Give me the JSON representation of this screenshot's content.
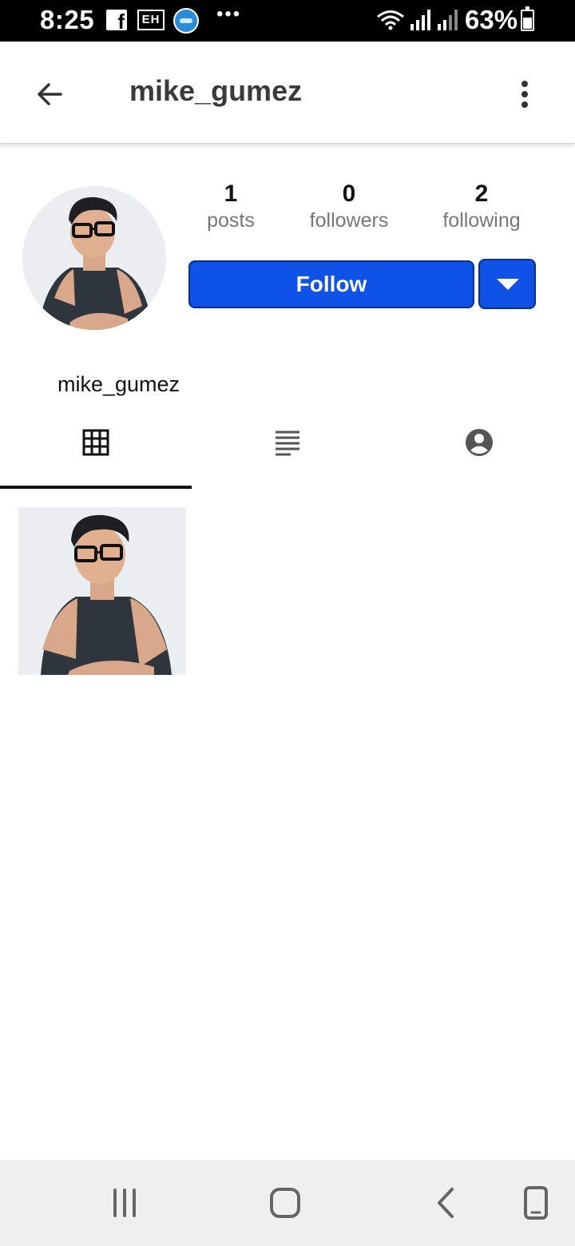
{
  "status_bar": {
    "time": "8:25",
    "battery": "63%",
    "battery_level": 0.63,
    "notification_icons": [
      "facebook-icon",
      "eh-icon",
      "globe-app-icon",
      "more-dots-icon"
    ],
    "system_icons": [
      "wifi-icon",
      "signal-icon",
      "signal-icon",
      "battery-icon"
    ]
  },
  "header": {
    "title": "mike_gumez",
    "back_icon": "arrow-left-icon",
    "menu_icon": "more-vert-icon"
  },
  "profile": {
    "username": "mike_gumez",
    "stats": [
      {
        "value": "1",
        "label": "posts"
      },
      {
        "value": "0",
        "label": "followers"
      },
      {
        "value": "2",
        "label": "following"
      }
    ],
    "follow_label": "Follow",
    "dropdown_icon": "caret-down-icon"
  },
  "tabs": [
    {
      "icon": "grid-icon",
      "active": true
    },
    {
      "icon": "list-icon",
      "active": false
    },
    {
      "icon": "person-circle-icon",
      "active": false
    }
  ],
  "posts_count": 1,
  "nav_bar": [
    "recents-icon",
    "home-icon",
    "back-icon",
    "rotate-icon"
  ],
  "colors": {
    "follow_button": "#0f52e8",
    "follow_border": "#0a2f88",
    "status_bar": "#000000",
    "nav_bar": "#f0f0f0"
  }
}
